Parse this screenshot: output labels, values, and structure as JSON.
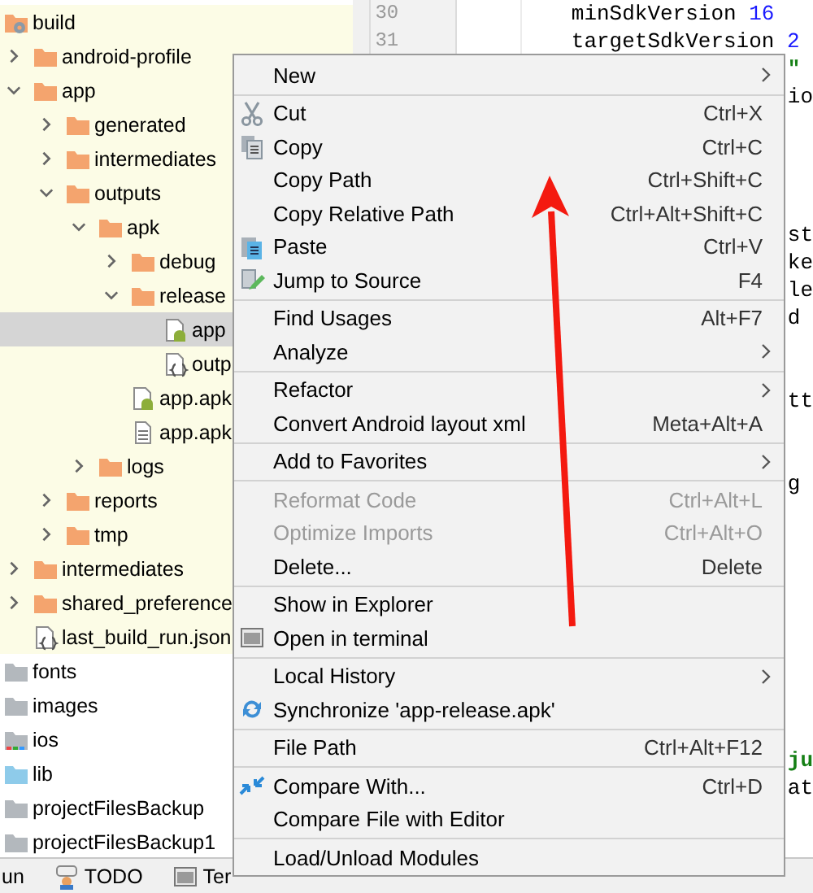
{
  "project_tree": [
    {
      "label": "build",
      "kind": "build",
      "selected": false,
      "children": [
        {
          "label": "android-profile",
          "kind": "folder",
          "expanded": false,
          "selected": false
        },
        {
          "label": "app",
          "kind": "folder",
          "expanded": true,
          "selected": false,
          "children": [
            {
              "label": "generated",
              "kind": "folder",
              "expanded": false,
              "selected": false
            },
            {
              "label": "intermediates",
              "kind": "folder",
              "expanded": false,
              "selected": false
            },
            {
              "label": "outputs",
              "kind": "folder",
              "expanded": true,
              "selected": false,
              "children": [
                {
                  "label": "apk",
                  "kind": "folder",
                  "expanded": true,
                  "selected": false,
                  "children": [
                    {
                      "label": "debug",
                      "kind": "folder",
                      "expanded": false,
                      "selected": false
                    },
                    {
                      "label": "release",
                      "kind": "folder",
                      "expanded": true,
                      "selected": false,
                      "children": [
                        {
                          "label": "app",
                          "kind": "apk",
                          "selected": true
                        },
                        {
                          "label": "outp",
                          "kind": "json",
                          "selected": false
                        }
                      ]
                    },
                    {
                      "label": "app.apk",
                      "kind": "apk",
                      "selected": false
                    },
                    {
                      "label": "app.apk",
                      "kind": "text",
                      "selected": false
                    }
                  ]
                },
                {
                  "label": "logs",
                  "kind": "folder",
                  "expanded": false,
                  "selected": false
                }
              ]
            },
            {
              "label": "reports",
              "kind": "folder",
              "expanded": false,
              "selected": false
            },
            {
              "label": "tmp",
              "kind": "folder",
              "expanded": false,
              "selected": false
            }
          ]
        },
        {
          "label": "intermediates",
          "kind": "folder",
          "expanded": false,
          "selected": false
        },
        {
          "label": "shared_preference",
          "kind": "folder",
          "expanded": false,
          "selected": false
        },
        {
          "label": "last_build_run.json",
          "kind": "json",
          "selected": false
        }
      ]
    },
    {
      "label": "fonts",
      "kind": "plain",
      "selected": false
    },
    {
      "label": "images",
      "kind": "plain",
      "selected": false
    },
    {
      "label": "ios",
      "kind": "module",
      "selected": false
    },
    {
      "label": "lib",
      "kind": "resource",
      "selected": false
    },
    {
      "label": "projectFilesBackup",
      "kind": "plain",
      "selected": false
    },
    {
      "label": "projectFilesBackup1",
      "kind": "plain",
      "selected": false
    }
  ],
  "gutter": {
    "line_numbers": [
      "30",
      "31"
    ]
  },
  "editor": {
    "lines": [
      {
        "kind": "code",
        "tokens": [
          {
            "text": "minSdkVersion ",
            "kind": "plain"
          },
          {
            "text": "16",
            "kind": "number"
          }
        ]
      },
      {
        "kind": "code",
        "tokens": [
          {
            "text": "targetSdkVersion ",
            "kind": "plain"
          },
          {
            "text": "2",
            "kind": "number"
          }
        ]
      },
      {
        "kind": "fragment",
        "tokens": [
          {
            "text": "\"",
            "kind": "string"
          }
        ]
      },
      {
        "kind": "fragment",
        "tokens": [
          {
            "text": "io",
            "kind": "plain"
          }
        ]
      },
      {
        "kind": "blank"
      },
      {
        "kind": "blank"
      },
      {
        "kind": "blank"
      },
      {
        "kind": "blank"
      },
      {
        "kind": "fragment",
        "tokens": [
          {
            "text": "st",
            "kind": "plain"
          }
        ]
      },
      {
        "kind": "fragment",
        "tokens": [
          {
            "text": "ke",
            "kind": "plain"
          }
        ]
      },
      {
        "kind": "fragment",
        "tokens": [
          {
            "text": "le",
            "kind": "plain"
          }
        ]
      },
      {
        "kind": "fragment",
        "tokens": [
          {
            "text": "d",
            "kind": "plain"
          }
        ]
      },
      {
        "kind": "blank"
      },
      {
        "kind": "blank"
      },
      {
        "kind": "fragment",
        "tokens": [
          {
            "text": "tt",
            "kind": "plain"
          }
        ]
      },
      {
        "kind": "blank"
      },
      {
        "kind": "blank"
      },
      {
        "kind": "fragment",
        "tokens": [
          {
            "text": "g",
            "kind": "plain"
          }
        ]
      },
      {
        "kind": "blank"
      },
      {
        "kind": "blank"
      },
      {
        "kind": "blank"
      },
      {
        "kind": "blank"
      },
      {
        "kind": "blank"
      },
      {
        "kind": "blank"
      },
      {
        "kind": "blank"
      },
      {
        "kind": "blank"
      },
      {
        "kind": "blank"
      },
      {
        "kind": "fragment",
        "tokens": [
          {
            "text": "ju",
            "kind": "string"
          }
        ]
      },
      {
        "kind": "fragment",
        "tokens": [
          {
            "text": "at",
            "kind": "plain"
          }
        ]
      }
    ]
  },
  "context_menu": {
    "groups": [
      [
        {
          "label": "New",
          "kind": "plain",
          "submenu": true,
          "disabled": false
        }
      ],
      [
        {
          "label": "Cut",
          "shortcut": "Ctrl+X",
          "kind": "cut",
          "disabled": false
        },
        {
          "label": "Copy",
          "shortcut": "Ctrl+C",
          "kind": "copy",
          "disabled": false
        },
        {
          "label": "Copy Path",
          "shortcut": "Ctrl+Shift+C",
          "kind": "plain",
          "disabled": false
        },
        {
          "label": "Copy Relative Path",
          "shortcut": "Ctrl+Alt+Shift+C",
          "kind": "plain",
          "disabled": false
        },
        {
          "label": "Paste",
          "shortcut": "Ctrl+V",
          "kind": "paste",
          "disabled": false
        },
        {
          "label": "Jump to Source",
          "shortcut": "F4",
          "kind": "jump",
          "disabled": false
        }
      ],
      [
        {
          "label": "Find Usages",
          "shortcut": "Alt+F7",
          "kind": "plain",
          "disabled": false
        },
        {
          "label": "Analyze",
          "kind": "plain",
          "submenu": true,
          "disabled": false
        }
      ],
      [
        {
          "label": "Refactor",
          "kind": "plain",
          "submenu": true,
          "disabled": false
        },
        {
          "label": "Convert Android layout xml",
          "shortcut": "Meta+Alt+A",
          "kind": "plain",
          "disabled": false
        }
      ],
      [
        {
          "label": "Add to Favorites",
          "kind": "plain",
          "submenu": true,
          "disabled": false
        }
      ],
      [
        {
          "label": "Reformat Code",
          "shortcut": "Ctrl+Alt+L",
          "kind": "plain",
          "disabled": true
        },
        {
          "label": "Optimize Imports",
          "shortcut": "Ctrl+Alt+O",
          "kind": "plain",
          "disabled": true
        },
        {
          "label": "Delete...",
          "shortcut": "Delete",
          "kind": "plain",
          "disabled": false
        }
      ],
      [
        {
          "label": "Show in Explorer",
          "kind": "plain",
          "disabled": false
        },
        {
          "label": "Open in terminal",
          "kind": "terminal",
          "disabled": false
        }
      ],
      [
        {
          "label": "Local History",
          "kind": "plain",
          "submenu": true,
          "disabled": false
        },
        {
          "label": "Synchronize 'app-release.apk'",
          "kind": "sync",
          "disabled": false
        }
      ],
      [
        {
          "label": "File Path",
          "shortcut": "Ctrl+Alt+F12",
          "kind": "plain",
          "disabled": false
        }
      ],
      [
        {
          "label": "Compare With...",
          "shortcut": "Ctrl+D",
          "kind": "compare",
          "disabled": false
        },
        {
          "label": "Compare File with Editor",
          "kind": "plain",
          "disabled": false
        }
      ],
      [
        {
          "label": "Load/Unload Modules",
          "kind": "plain",
          "disabled": false
        }
      ]
    ]
  },
  "tool_windows": [
    {
      "label": "un",
      "kind": "plain"
    },
    {
      "label": "TODO",
      "kind": "todo"
    },
    {
      "label": "Ter",
      "kind": "terminal"
    }
  ]
}
